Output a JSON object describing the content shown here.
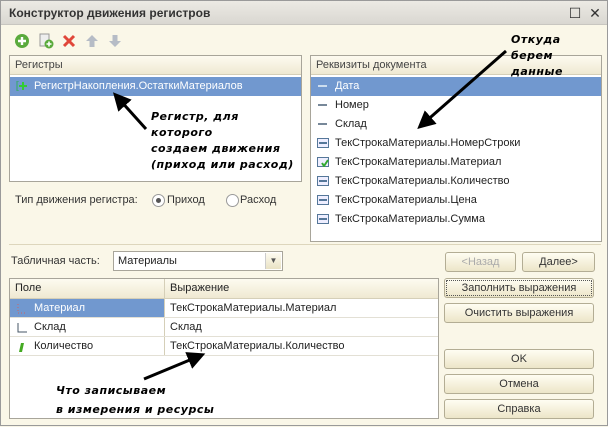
{
  "window": {
    "title": "Конструктор движения регистров"
  },
  "toolbar": [
    "add-icon",
    "add-copy-icon",
    "delete-icon",
    "move-up-icon",
    "move-down-icon"
  ],
  "registers": {
    "header": "Регистры",
    "items": [
      {
        "label": "РегистрНакопления.ОстаткиМатериалов",
        "selected": true
      }
    ]
  },
  "movement_type": {
    "label": "Тип движения регистра:",
    "options": [
      "Приход",
      "Расход"
    ],
    "selected": "Приход"
  },
  "attributes": {
    "header": "Реквизиты документа",
    "items": [
      {
        "label": "Дата",
        "icon": "attribute-icon",
        "selected": true
      },
      {
        "label": "Номер",
        "icon": "attribute-icon"
      },
      {
        "label": "Склад",
        "icon": "attribute-icon"
      },
      {
        "label": "ТекСтрокаМатериалы.НомерСтроки",
        "icon": "table-attribute-icon"
      },
      {
        "label": "ТекСтрокаМатериалы.Материал",
        "icon": "table-attribute-checked-icon"
      },
      {
        "label": "ТекСтрокаМатериалы.Количество",
        "icon": "table-attribute-icon"
      },
      {
        "label": "ТекСтрокаМатериалы.Цена",
        "icon": "table-attribute-icon"
      },
      {
        "label": "ТекСтрокаМатериалы.Сумма",
        "icon": "table-attribute-icon"
      }
    ]
  },
  "tabular": {
    "label": "Табличная часть:",
    "value": "Материалы"
  },
  "grid": {
    "columns": [
      "Поле",
      "Выражение"
    ],
    "rows": [
      {
        "field": "Материал",
        "expr": "ТекСтрокаМатериалы.Материал",
        "icon": "dimension-icon",
        "selected": true
      },
      {
        "field": "Склад",
        "expr": "Склад",
        "icon": "dimension-icon"
      },
      {
        "field": "Количество",
        "expr": "ТекСтрокаМатериалы.Количество",
        "icon": "resource-icon"
      }
    ]
  },
  "buttons": {
    "back": "<Назад",
    "next": "Далее>",
    "fill": "Заполнить выражения",
    "clear": "Очистить выражения",
    "ok": "OK",
    "cancel": "Отмена",
    "help": "Справка"
  },
  "notes": {
    "register": [
      "Регистр, для",
      "которого",
      "создаем движения",
      "(приход или расход)"
    ],
    "source": [
      "Откуда",
      "берем",
      "данные"
    ],
    "target": [
      "Что записываем",
      "в измерения и ресурсы"
    ]
  }
}
